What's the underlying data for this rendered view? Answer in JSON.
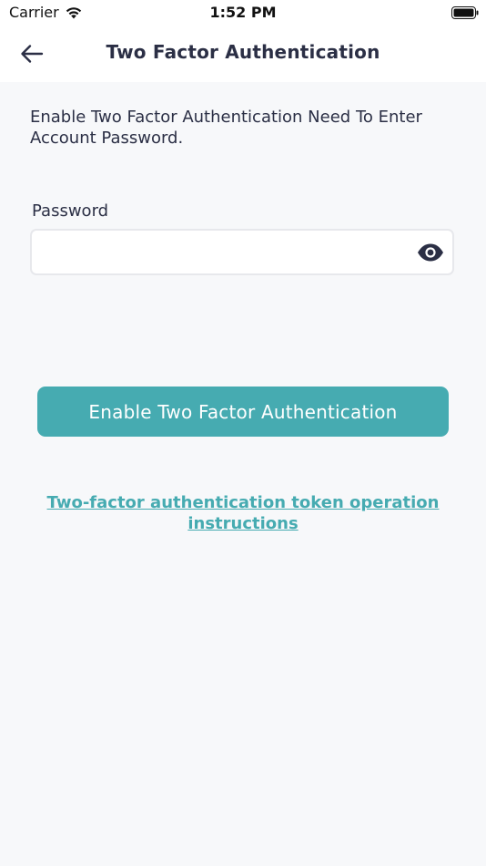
{
  "status_bar": {
    "carrier": "Carrier",
    "time": "1:52 PM",
    "icons": [
      "wifi-icon",
      "battery-icon"
    ]
  },
  "nav": {
    "title": "Two Factor Authentication",
    "back_icon": "arrow-left-icon"
  },
  "content": {
    "intro_text": "Enable Two Factor Authentication Need To Enter Account Password.",
    "password_label": "Password",
    "password_value": "",
    "password_placeholder": "",
    "eye_icon": "eye-icon",
    "enable_button_label": "Enable Two Factor Authentication",
    "help_link_text": "Two-factor authentication token operation instructions"
  },
  "colors": {
    "accent": "#46abb1",
    "text_dark": "#2b2f45",
    "background": "#f7f8fa",
    "surface": "#ffffff",
    "field_border": "#e7e8ec"
  }
}
